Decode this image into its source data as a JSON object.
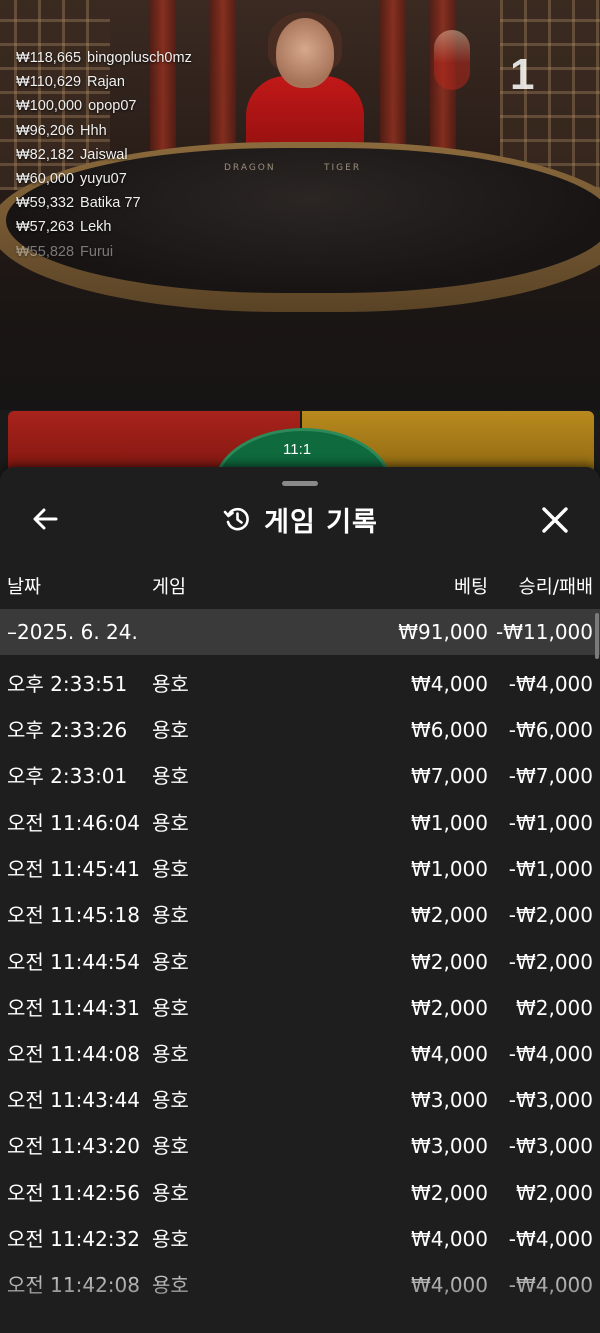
{
  "stream": {
    "round_number": "1",
    "table_labels": [
      "DRAGON",
      "TIGER"
    ],
    "leaderboard": [
      {
        "amount": "₩118,665",
        "name": "bingoplusch0mz"
      },
      {
        "amount": "₩110,629",
        "name": "Rajan"
      },
      {
        "amount": "₩100,000",
        "name": "opop07"
      },
      {
        "amount": "₩96,206",
        "name": "Hhh"
      },
      {
        "amount": "₩82,182",
        "name": "Jaiswal"
      },
      {
        "amount": "₩60,000",
        "name": "yuyu07"
      },
      {
        "amount": "₩59,332",
        "name": "Batika 77"
      },
      {
        "amount": "₩57,263",
        "name": "Lekh"
      },
      {
        "amount": "₩55,828",
        "name": "Furui"
      }
    ],
    "board_ratio": "11:1"
  },
  "sheet": {
    "title": "게임 기록",
    "icons": {
      "back": "back-arrow-icon",
      "history": "history-icon",
      "close": "close-icon"
    },
    "columns": {
      "date": "날짜",
      "game": "게임",
      "bet": "베팅",
      "result": "승리/패배"
    },
    "date_group": {
      "label": "–2025. 6. 24.",
      "bet": "₩91,000",
      "result": "-₩11,000"
    },
    "rows": [
      {
        "time": "오후 2:33:51",
        "game": "용호",
        "bet": "₩4,000",
        "result": "-₩4,000"
      },
      {
        "time": "오후 2:33:26",
        "game": "용호",
        "bet": "₩6,000",
        "result": "-₩6,000"
      },
      {
        "time": "오후 2:33:01",
        "game": "용호",
        "bet": "₩7,000",
        "result": "-₩7,000"
      },
      {
        "time": "오전 11:46:04",
        "game": "용호",
        "bet": "₩1,000",
        "result": "-₩1,000"
      },
      {
        "time": "오전 11:45:41",
        "game": "용호",
        "bet": "₩1,000",
        "result": "-₩1,000"
      },
      {
        "time": "오전 11:45:18",
        "game": "용호",
        "bet": "₩2,000",
        "result": "-₩2,000"
      },
      {
        "time": "오전 11:44:54",
        "game": "용호",
        "bet": "₩2,000",
        "result": "-₩2,000"
      },
      {
        "time": "오전 11:44:31",
        "game": "용호",
        "bet": "₩2,000",
        "result": "₩2,000"
      },
      {
        "time": "오전 11:44:08",
        "game": "용호",
        "bet": "₩4,000",
        "result": "-₩4,000"
      },
      {
        "time": "오전 11:43:44",
        "game": "용호",
        "bet": "₩3,000",
        "result": "-₩3,000"
      },
      {
        "time": "오전 11:43:20",
        "game": "용호",
        "bet": "₩3,000",
        "result": "-₩3,000"
      },
      {
        "time": "오전 11:42:56",
        "game": "용호",
        "bet": "₩2,000",
        "result": "₩2,000"
      },
      {
        "time": "오전 11:42:32",
        "game": "용호",
        "bet": "₩4,000",
        "result": "-₩4,000"
      },
      {
        "time": "오전 11:42:08",
        "game": "용호",
        "bet": "₩4,000",
        "result": "-₩4,000"
      }
    ]
  }
}
